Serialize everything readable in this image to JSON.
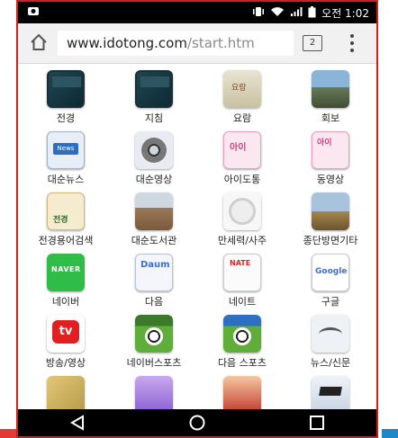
{
  "status_bar": {
    "time": "오전 1:02",
    "left_icon": "notification-icon",
    "right_icons": [
      "vibrate-icon",
      "wifi-icon",
      "signal-icon",
      "battery-icon"
    ]
  },
  "browser": {
    "url_host": "www.idotong.com",
    "url_path": "/start.htm",
    "tab_count": "2",
    "home_icon": "home-icon",
    "menu_icon": "overflow-menu-icon"
  },
  "apps": [
    {
      "label": "전경",
      "icon": "book-icon"
    },
    {
      "label": "지침",
      "icon": "book-icon"
    },
    {
      "label": "요람",
      "icon": "scroll-icon"
    },
    {
      "label": "회보",
      "icon": "photo-icon"
    },
    {
      "label": "대순뉴스",
      "icon": "news-icon"
    },
    {
      "label": "대순영상",
      "icon": "film-reel-icon"
    },
    {
      "label": "아이도통",
      "icon": "idotong-logo-icon"
    },
    {
      "label": "동영상",
      "icon": "video-icon"
    },
    {
      "label": "전경용어검색",
      "icon": "dictionary-icon"
    },
    {
      "label": "대순도서관",
      "icon": "library-icon"
    },
    {
      "label": "만세력/사주",
      "icon": "calendar-icon"
    },
    {
      "label": "종단방면기타",
      "icon": "building-icon"
    },
    {
      "label": "네이버",
      "icon": "naver-logo-icon"
    },
    {
      "label": "다음",
      "icon": "daum-logo-icon"
    },
    {
      "label": "네이트",
      "icon": "nate-logo-icon"
    },
    {
      "label": "구글",
      "icon": "google-logo-icon"
    },
    {
      "label": "방송/영상",
      "icon": "tv-icon"
    },
    {
      "label": "네이버스포츠",
      "icon": "soccer-ball-icon"
    },
    {
      "label": "다음 스포츠",
      "icon": "soccer-ball-icon"
    },
    {
      "label": "뉴스/신문",
      "icon": "glasses-icon"
    },
    {
      "label": "",
      "icon": "map-icon"
    },
    {
      "label": "",
      "icon": "chart-icon"
    },
    {
      "label": "",
      "icon": "books-icon"
    },
    {
      "label": "",
      "icon": "graduation-cap-icon"
    }
  ],
  "navbar": {
    "back_icon": "back-icon",
    "home_icon": "home-circle-icon",
    "recents_icon": "recents-icon"
  },
  "colors": {
    "frame_border": "#c8231f",
    "status_bar": "#000000",
    "address_bar": "#f1f1f1",
    "navbar": "#000000"
  }
}
